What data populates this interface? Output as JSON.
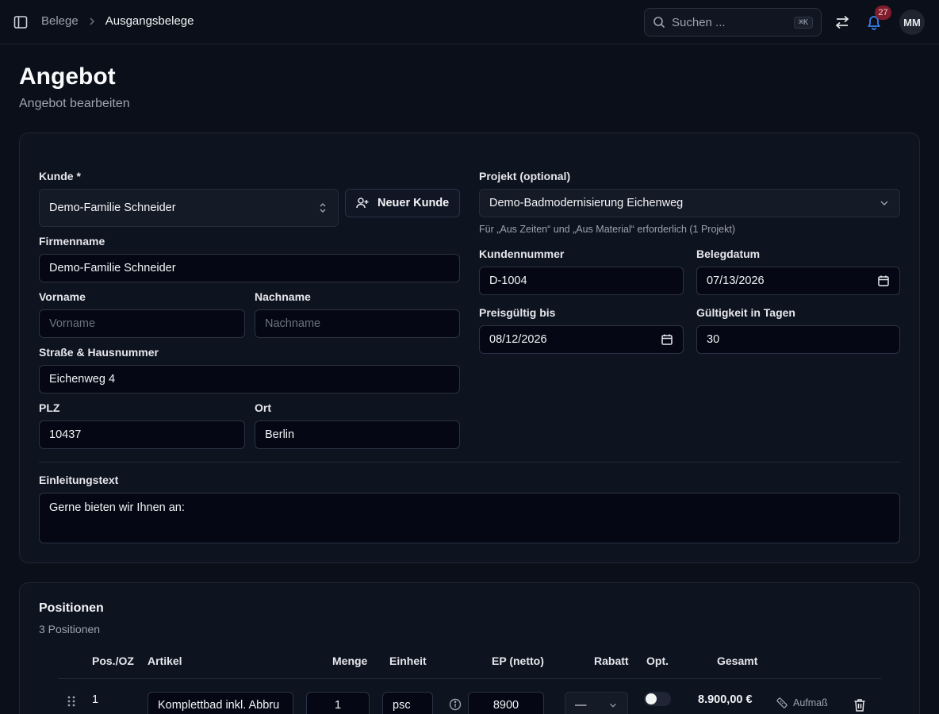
{
  "header": {
    "breadcrumb": [
      "Belege",
      "Ausgangsbelege"
    ],
    "search_placeholder": "Suchen ...",
    "search_shortcut": "⌘K",
    "notification_count": "27",
    "avatar_initials": "MM"
  },
  "page": {
    "title": "Angebot",
    "subtitle": "Angebot bearbeiten"
  },
  "form": {
    "customer": {
      "label": "Kunde *",
      "value": "Demo-Familie Schneider"
    },
    "new_customer_label": "Neuer Kunde",
    "project": {
      "label": "Projekt (optional)",
      "value": "Demo-Badmodernisierung Eichenweg",
      "hint": "Für „Aus Zeiten“ und „Aus Material“ erforderlich (1 Projekt)"
    },
    "company": {
      "label": "Firmenname",
      "value": "Demo-Familie Schneider"
    },
    "first_name": {
      "label": "Vorname",
      "placeholder": "Vorname"
    },
    "last_name": {
      "label": "Nachname",
      "placeholder": "Nachname"
    },
    "street": {
      "label": "Straße & Hausnummer",
      "value": "Eichenweg 4"
    },
    "zip": {
      "label": "PLZ",
      "value": "10437"
    },
    "city": {
      "label": "Ort",
      "value": "Berlin"
    },
    "customer_number": {
      "label": "Kundennummer",
      "value": "D-1004"
    },
    "doc_date": {
      "label": "Belegdatum",
      "value": "07/13/2026"
    },
    "valid_until": {
      "label": "Preisgültig bis",
      "value": "08/12/2026"
    },
    "validity_days": {
      "label": "Gültigkeit in Tagen",
      "value": "30"
    },
    "intro": {
      "label": "Einleitungstext",
      "value": "Gerne bieten wir Ihnen an:"
    }
  },
  "positions": {
    "title": "Positionen",
    "count_text": "3 Positionen",
    "columns": [
      "Pos./OZ",
      "Artikel",
      "Menge",
      "Einheit",
      "EP (netto)",
      "Rabatt",
      "Opt.",
      "Gesamt"
    ],
    "rows": [
      {
        "pos": "1",
        "article": "Komplettbad inkl. Abbru",
        "qty": "1",
        "unit": "psc",
        "price": "8900",
        "discount": "—",
        "optional": false,
        "total": "8.900,00 €",
        "measure_label": "Aufmaß"
      }
    ]
  },
  "icons": [
    "sidebar-toggle-icon",
    "chevron-right-icon",
    "search-icon",
    "swap-icon",
    "bell-icon",
    "updown-chevron-icon",
    "user-plus-icon",
    "chevron-down-icon",
    "calendar-icon",
    "drag-handle-icon",
    "info-icon",
    "ruler-icon",
    "trash-icon"
  ]
}
